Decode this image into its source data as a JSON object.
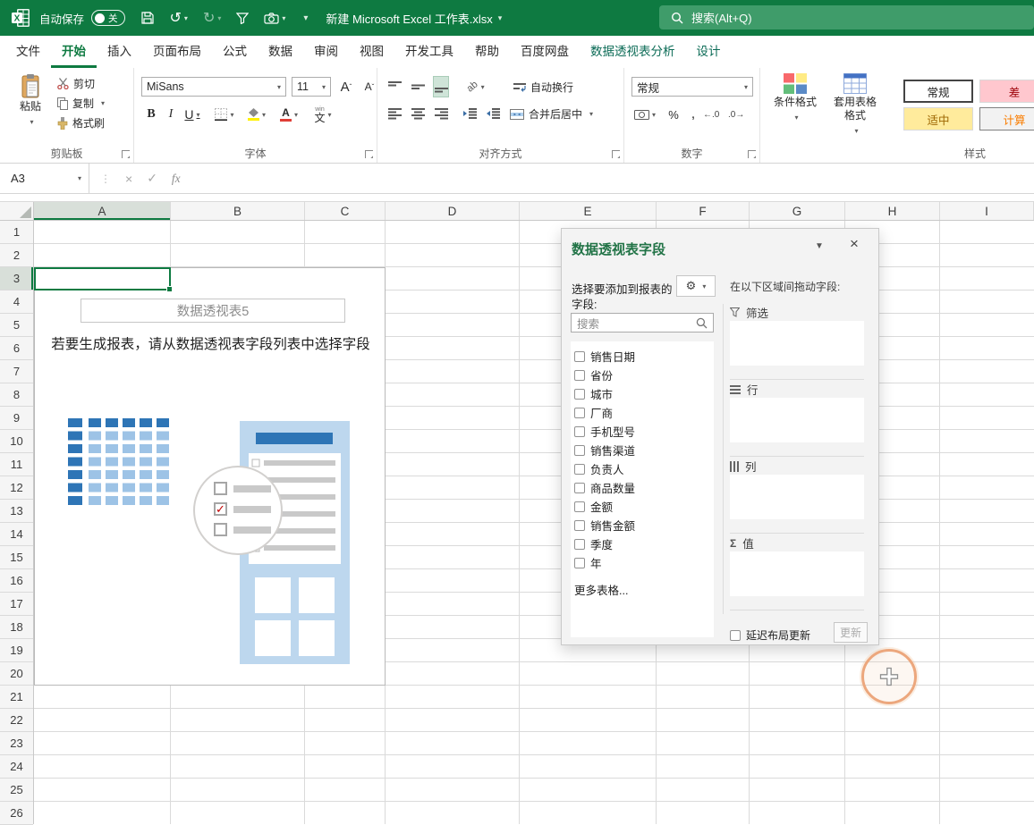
{
  "titlebar": {
    "autosave_label": "自动保存",
    "autosave_state": "关",
    "doc_title": "新建 Microsoft Excel 工作表.xlsx",
    "search_placeholder": "搜索(Alt+Q)"
  },
  "tabs": {
    "items": [
      "文件",
      "开始",
      "插入",
      "页面布局",
      "公式",
      "数据",
      "审阅",
      "视图",
      "开发工具",
      "帮助",
      "百度网盘",
      "数据透视表分析",
      "设计"
    ],
    "active": "开始",
    "contextual": [
      "数据透视表分析",
      "设计"
    ]
  },
  "ribbon": {
    "clipboard": {
      "label": "剪贴板",
      "paste": "粘贴",
      "cut": "剪切",
      "copy": "复制",
      "painter": "格式刷"
    },
    "font": {
      "label": "字体",
      "name": "MiSans",
      "size": "11"
    },
    "alignment": {
      "label": "对齐方式",
      "wrap": "自动换行",
      "merge": "合并后居中"
    },
    "number": {
      "label": "数字",
      "format": "常规"
    },
    "styles": {
      "label": "样式",
      "conditional": "条件格式",
      "table": "套用表格格式",
      "cells": [
        {
          "label": "常规",
          "bg": "#FFFFFF",
          "text": "#1f1f1f",
          "selected": true
        },
        {
          "label": "差",
          "bg": "#FFC7CE",
          "text": "#9C0006"
        },
        {
          "label": "适中",
          "bg": "#FFEB9C",
          "text": "#9C6500"
        },
        {
          "label": "计算",
          "bg": "#F2F2F2",
          "text": "#FA7D00",
          "border": "#7F7F7F"
        }
      ]
    }
  },
  "formula_bar": {
    "cell_ref": "A3",
    "fx_label": "fx"
  },
  "grid": {
    "columns": [
      "A",
      "B",
      "C",
      "D",
      "E",
      "F",
      "G",
      "H",
      "I"
    ],
    "row_start": 1,
    "row_end": 26,
    "selected_cell": "A3"
  },
  "pivot_placeholder": {
    "title": "数据透视表5",
    "message": "若要生成报表，请从数据透视表字段列表中选择字段"
  },
  "fields_panel": {
    "title": "数据透视表字段",
    "choose_label": "选择要添加到报表的字段:",
    "search_placeholder": "搜索",
    "fields": [
      "销售日期",
      "省份",
      "城市",
      "厂商",
      "手机型号",
      "销售渠道",
      "负责人",
      "商品数量",
      "金额",
      "销售金额",
      "季度",
      "年"
    ],
    "more_tables": "更多表格...",
    "drag_label": "在以下区域间拖动字段:",
    "areas": [
      {
        "icon": "filter",
        "label": "筛选"
      },
      {
        "icon": "rows",
        "label": "行"
      },
      {
        "icon": "columns",
        "label": "列"
      },
      {
        "icon": "values",
        "label": "值"
      }
    ],
    "defer_label": "延迟布局更新",
    "update_label": "更新"
  },
  "colors": {
    "excel_green": "#0E7A41",
    "contextual_tab": "#0B6B56",
    "panel_title": "#217346",
    "selection": "#0E7A41",
    "click_highlight": "#ECA77D"
  }
}
